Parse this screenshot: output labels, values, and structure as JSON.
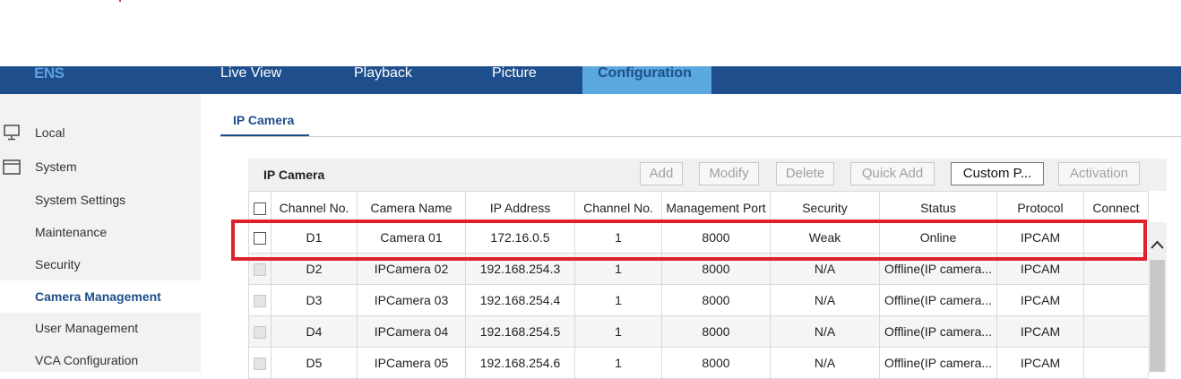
{
  "header": {
    "logo": "ENS",
    "nav": [
      "Live View",
      "Playback",
      "Picture"
    ],
    "nav_active": "Configuration"
  },
  "sidebar": {
    "local": "Local",
    "system": "System",
    "items": [
      "System Settings",
      "Maintenance",
      "Security"
    ],
    "active": "Camera Management",
    "items_after": [
      "User Management",
      "VCA Configuration"
    ]
  },
  "tab": {
    "label": "IP Camera"
  },
  "panel": {
    "title": "IP Camera",
    "buttons": {
      "add": "Add",
      "modify": "Modify",
      "delete": "Delete",
      "quick_add": "Quick Add",
      "custom": "Custom P...",
      "activation": "Activation"
    }
  },
  "table": {
    "headers": [
      "Channel No.",
      "Camera Name",
      "IP Address",
      "Channel No.",
      "Management Port",
      "Security",
      "Status",
      "Protocol",
      "Connect"
    ],
    "rows": [
      [
        "D1",
        "Camera 01",
        "172.16.0.5",
        "1",
        "8000",
        "Weak",
        "Online",
        "IPCAM",
        ""
      ],
      [
        "D2",
        "IPCamera 02",
        "192.168.254.3",
        "1",
        "8000",
        "N/A",
        "Offline(IP camera...",
        "IPCAM",
        ""
      ],
      [
        "D3",
        "IPCamera 03",
        "192.168.254.4",
        "1",
        "8000",
        "N/A",
        "Offline(IP camera...",
        "IPCAM",
        ""
      ],
      [
        "D4",
        "IPCamera 04",
        "192.168.254.5",
        "1",
        "8000",
        "N/A",
        "Offline(IP camera...",
        "IPCAM",
        ""
      ],
      [
        "D5",
        "IPCamera 05",
        "192.168.254.6",
        "1",
        "8000",
        "N/A",
        "Offline(IP camera...",
        "IPCAM",
        ""
      ]
    ]
  },
  "colors": {
    "header_bg": "#1f4e8c",
    "nav_active_bg": "#5aa8dd",
    "highlight": "#e0212b"
  },
  "icons": {
    "local": "monitor-icon",
    "system": "window-icon",
    "scroll_up": "chevron-up-icon"
  }
}
